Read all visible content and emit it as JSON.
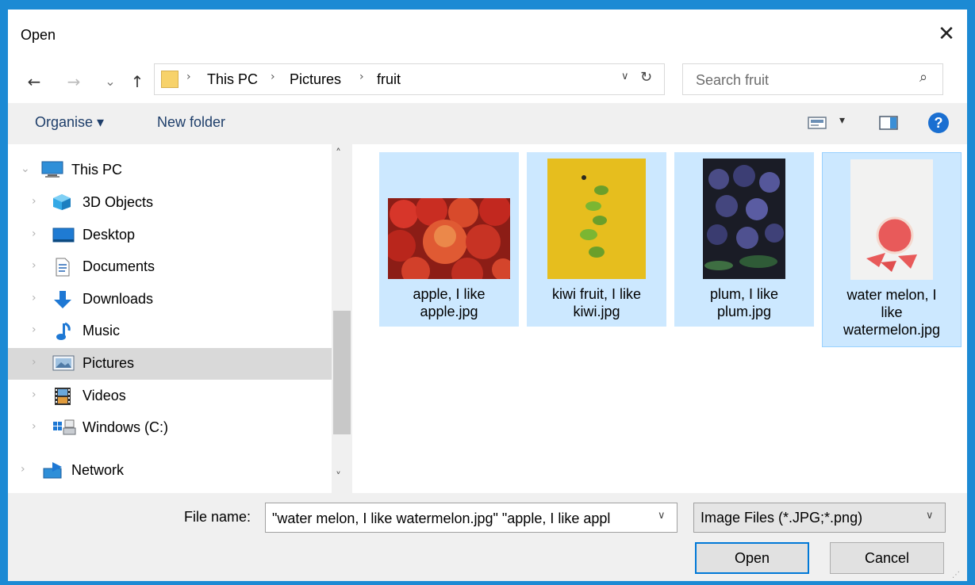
{
  "window": {
    "title": "Open",
    "close_glyph": "✕"
  },
  "nav": {
    "back_glyph": "←",
    "forward_glyph": "→",
    "recent_glyph": "⌄",
    "up_glyph": "↑",
    "breadcrumb": [
      "This PC",
      "Pictures",
      "fruit"
    ],
    "separator": "›",
    "address_dropdown_glyph": "∨",
    "refresh_glyph": "↻"
  },
  "search": {
    "placeholder": "Search fruit",
    "icon": "search-icon",
    "glyph": "⌕"
  },
  "toolbar": {
    "organise_label": "Organise ▾",
    "new_folder_label": "New folder",
    "view_dropdown_glyph": "▾",
    "help_glyph": "?"
  },
  "sidebar": {
    "items": [
      {
        "label": "This PC",
        "icon": "computer-icon"
      },
      {
        "label": "3D Objects",
        "icon": "cube-icon"
      },
      {
        "label": "Desktop",
        "icon": "desktop-icon"
      },
      {
        "label": "Documents",
        "icon": "document-icon"
      },
      {
        "label": "Downloads",
        "icon": "download-arrow-icon"
      },
      {
        "label": "Music",
        "icon": "music-note-icon"
      },
      {
        "label": "Pictures",
        "icon": "pictures-icon",
        "selected": true
      },
      {
        "label": "Videos",
        "icon": "film-icon"
      },
      {
        "label": "Windows (C:)",
        "icon": "drive-icon"
      },
      {
        "label": "Network",
        "icon": "network-icon"
      }
    ],
    "scroll_up_glyph": "˄",
    "scroll_down_glyph": "˅"
  },
  "files": [
    {
      "name": "apple, I like apple.jpg",
      "name_lines": [
        "apple, I like",
        "apple.jpg"
      ],
      "selected": true
    },
    {
      "name": "kiwi fruit, I like kiwi.jpg",
      "name_lines": [
        "kiwi fruit, I like",
        "kiwi.jpg"
      ],
      "selected": true
    },
    {
      "name": "plum, I like plum.jpg",
      "name_lines": [
        "plum, I like",
        "plum.jpg"
      ],
      "selected": true
    },
    {
      "name": "water melon, I like watermelon.jpg",
      "name_lines": [
        "water melon, I",
        "like",
        "watermelon.jpg"
      ],
      "selected": true,
      "focused": true
    }
  ],
  "footer": {
    "file_name_label": "File name:",
    "file_name_value": "\"water melon, I like watermelon.jpg\" \"apple, I like appl",
    "file_name_dropdown_glyph": "∨",
    "file_type_value": "Image Files (*.JPG;*.png)",
    "file_type_dropdown_glyph": "∨",
    "open_label": "Open",
    "cancel_label": "Cancel",
    "resize_grip_glyph": "⋰"
  },
  "colors": {
    "frame": "#1c8ad4",
    "selection": "#cce8ff",
    "accent": "#0078d7",
    "help": "#1a6fd1"
  }
}
